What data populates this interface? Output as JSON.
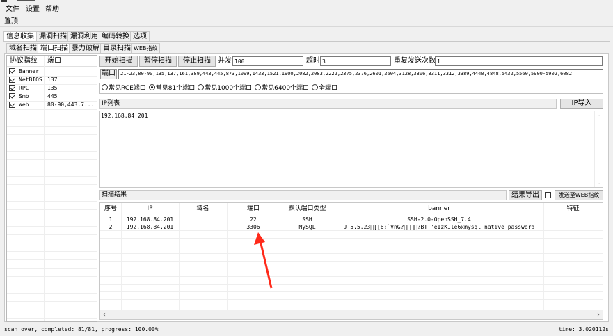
{
  "menu": [
    "文件",
    "设置",
    "帮助"
  ],
  "toolbar_label": "置顶",
  "main_tabs": [
    "信息收集",
    "漏洞扫描",
    "漏洞利用",
    "编码转换",
    "选项"
  ],
  "sub_tabs": [
    "域名扫描",
    "端口扫描",
    "暴力破解",
    "目录扫描",
    "WEB指纹"
  ],
  "left_panel": {
    "headers": [
      "协议指纹",
      "端口"
    ],
    "rows": [
      {
        "name": "Banner",
        "port": "",
        "checked": true
      },
      {
        "name": "NetBIOS",
        "port": "137",
        "checked": true
      },
      {
        "name": "RPC",
        "port": "135",
        "checked": true
      },
      {
        "name": "Smb",
        "port": "445",
        "checked": true
      },
      {
        "name": "Web",
        "port": "80-90,443,7...",
        "checked": true
      }
    ]
  },
  "controls": {
    "start_button": "开始扫描",
    "pause_button": "暂停扫描",
    "stop_button": "停止扫描",
    "concurrency_label": "并发",
    "concurrency_value": "100",
    "timeout_label": "超时",
    "timeout_value": "3",
    "retry_label": "重复发送次数",
    "retry_value": "1",
    "port_label": "端口",
    "port_value": "21-23,80-90,135,137,161,389,443,445,873,1099,1433,1521,1900,2082,2083,2222,2375,2376,2601,2604,3128,3306,3311,3312,3389,4440,4848,5432,5560,5900-5902,6082"
  },
  "port_presets": [
    {
      "label": "常见RCE端口",
      "selected": false
    },
    {
      "label": "常见81个端口",
      "selected": true
    },
    {
      "label": "常见1000个端口",
      "selected": false
    },
    {
      "label": "常见6400个端口",
      "selected": false
    },
    {
      "label": "全端口",
      "selected": false
    }
  ],
  "ip_list": {
    "label": "IP列表",
    "import_button": "IP导入",
    "content": "192.168.84.201"
  },
  "results": {
    "label": "扫描结果",
    "export_button": "结果导出",
    "send_button": "发送至WEB指纹",
    "columns": [
      "序号",
      "IP",
      "域名",
      "端口",
      "默认端口类型",
      "banner",
      "特征"
    ],
    "rows": [
      [
        "1",
        "192.168.84.201",
        "",
        "22",
        "SSH",
        "SSH-2.0-OpenSSH_7.4",
        ""
      ],
      [
        "2",
        "192.168.84.201",
        "",
        "3306",
        "MySQL",
        "J 5.5.23\u0000[[6:`VnG?\u0000\u0000\u0000\u0000?BTT'eIzKIle6xmysql_native_password",
        ""
      ]
    ]
  },
  "status": {
    "left": "scan over, completed: 81/81, progress: 100.00%",
    "right": "time: 3.020112s"
  },
  "colors": {
    "annotation_arrow": "#ff2a1a"
  }
}
